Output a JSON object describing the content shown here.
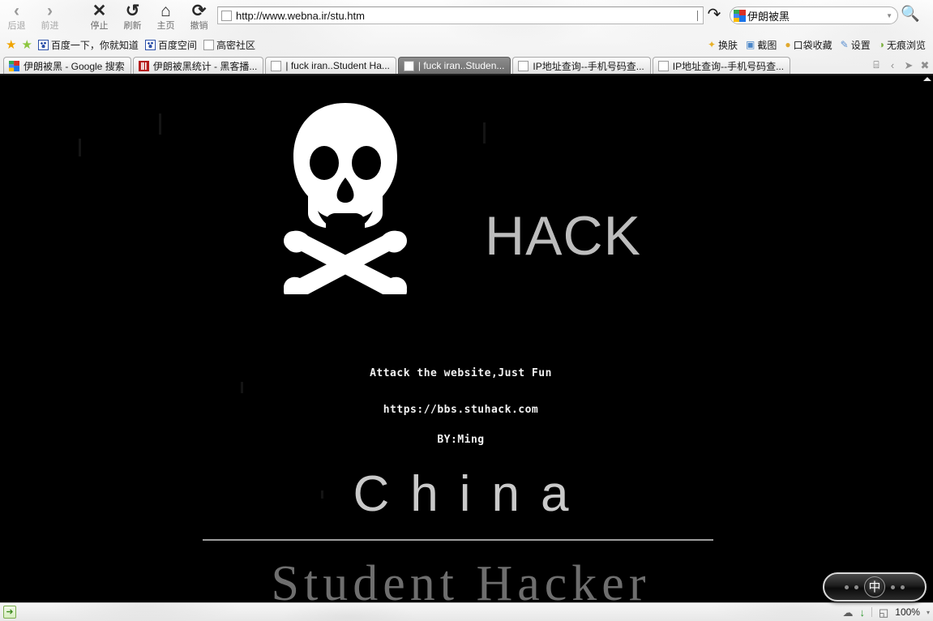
{
  "toolbar": {
    "buttons": [
      {
        "label": "后退",
        "icon": "back-arrow-icon",
        "glyph": "‹",
        "disabled": true
      },
      {
        "label": "前进",
        "icon": "forward-arrow-icon",
        "glyph": "›",
        "disabled": true
      },
      {
        "label": "停止",
        "icon": "stop-x-icon",
        "glyph": "✕",
        "disabled": false
      },
      {
        "label": "刷新",
        "icon": "refresh-icon",
        "glyph": "↺",
        "disabled": false
      },
      {
        "label": "主页",
        "icon": "home-icon",
        "glyph": "⌂",
        "disabled": false
      },
      {
        "label": "撤销",
        "icon": "undo-icon",
        "glyph": "⟳",
        "disabled": false
      }
    ],
    "address": {
      "value": "http://www.webna.ir/stu.htm",
      "page_icon": "page-icon",
      "go_icon": "go-arrow-icon"
    },
    "search": {
      "value": "伊朗被黑",
      "engine_icon": "google-icon",
      "dropdown_icon": "chevron-down-icon",
      "search_icon": "search-magnifier-icon"
    }
  },
  "bookmarks": {
    "star_icon": "star-icon",
    "add_star_icon": "add-star-icon",
    "items": [
      {
        "label": "百度一下，你就知道",
        "favicon": "baidu-favicon"
      },
      {
        "label": "百度空间",
        "favicon": "baidu-favicon"
      },
      {
        "label": "高密社区",
        "favicon": "blank-favicon"
      }
    ],
    "right_items": [
      {
        "label": "换肤",
        "icon": "✦",
        "color": "#e8b12a",
        "name": "skin-icon"
      },
      {
        "label": "截图",
        "icon": "▣",
        "color": "#4a86c8",
        "name": "screenshot-icon"
      },
      {
        "label": "口袋收藏",
        "icon": "●",
        "color": "#e0a92f",
        "name": "pocket-icon"
      },
      {
        "label": "设置",
        "icon": "✎",
        "color": "#5a8fd0",
        "name": "settings-icon"
      },
      {
        "label": "无痕浏览",
        "icon": "◑",
        "color": "#7aaf3e",
        "name": "incognito-icon"
      }
    ]
  },
  "tabs": {
    "items": [
      {
        "label": "伊朗被黑 - Google 搜索",
        "favicon": "google-favicon",
        "active": false
      },
      {
        "label": "伊朗被黑统计 - 黑客播...",
        "favicon": "red-favicon",
        "active": false
      },
      {
        "label": "| fuck iran..Student Ha...",
        "favicon": "blank-favicon",
        "active": false
      },
      {
        "label": "| fuck iran..Studen...",
        "favicon": "blank-favicon",
        "active": true
      },
      {
        "label": "IP地址查询--手机号码查...",
        "favicon": "blank-favicon",
        "active": false
      },
      {
        "label": "IP地址查询--手机号码查...",
        "favicon": "blank-favicon",
        "active": false
      }
    ],
    "controls": [
      {
        "name": "tab-list-icon",
        "glyph": "⌸"
      },
      {
        "name": "tab-prev-icon",
        "glyph": "‹"
      },
      {
        "name": "tab-next-icon",
        "glyph": "➤"
      },
      {
        "name": "tab-close-icon",
        "glyph": "✖"
      }
    ]
  },
  "page": {
    "background_color": "#000000",
    "skull_icon": "skull-and-crossbones-icon",
    "hack_word": "HACK",
    "hack_color": "#bdbdbd",
    "lines": [
      "Attack the website,Just Fun",
      "https://bbs.stuhack.com",
      "BY:Ming"
    ],
    "china": "China",
    "student_hacker": "Student Hacker",
    "scroll_up_icon": "scroll-up-arrow-icon"
  },
  "statusbar": {
    "left_icon": "page-load-icon",
    "right": {
      "shield_icon": "☁",
      "download_icon": "↓",
      "zoom_icon": "◱",
      "zoom_level": "100%",
      "zoom_caret": "▾"
    }
  },
  "ime": {
    "mode_label": "中",
    "left_dots": 2,
    "right_dots": 2
  }
}
